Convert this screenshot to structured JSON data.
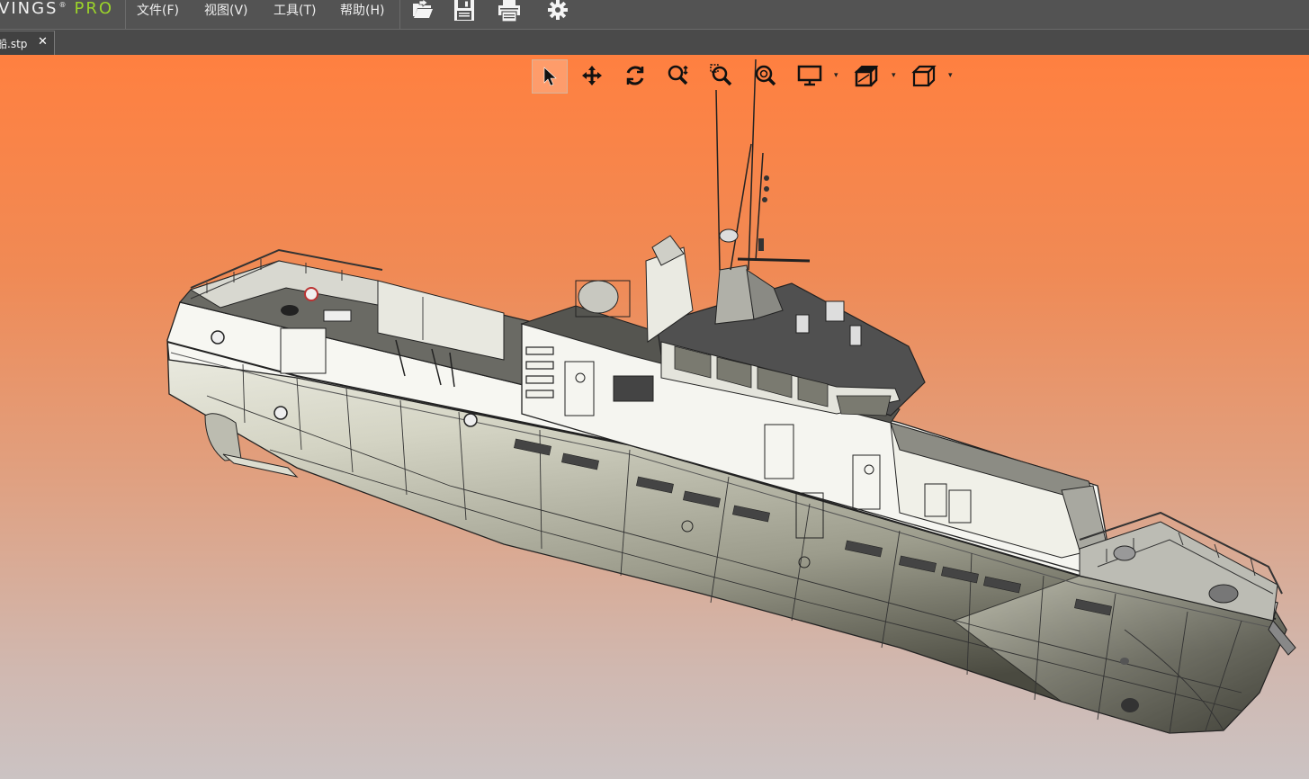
{
  "app": {
    "logo_text": "VINGS",
    "logo_reg": "®",
    "logo_suffix": "PRO",
    "accent_color": "#9bd32a"
  },
  "menu": {
    "items": [
      {
        "label": "文件(F)"
      },
      {
        "label": "视图(V)"
      },
      {
        "label": "工具(T)"
      },
      {
        "label": "帮助(H)"
      }
    ]
  },
  "main_toolbar": {
    "icons": [
      "open-file-icon",
      "save-icon",
      "print-icon",
      "settings-gear-icon"
    ]
  },
  "tabs": [
    {
      "label": "船.stp",
      "close": "✕",
      "active": true
    }
  ],
  "view_toolbar": {
    "tools": [
      "select-arrow-icon",
      "pan-move-icon",
      "rotate-icon",
      "zoom-icon",
      "zoom-window-icon",
      "zoom-fit-icon",
      "display-mode-icon",
      "section-box-icon",
      "standard-view-cube-icon"
    ],
    "active_tool": "select-arrow-icon",
    "dropdown_caret": "▾"
  },
  "viewport": {
    "background_top": "#ff8040",
    "background_bottom": "#cbc3c3",
    "model": "ship-3d-model"
  }
}
